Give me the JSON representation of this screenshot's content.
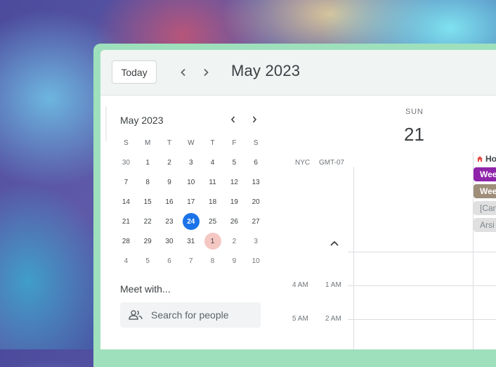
{
  "toolbar": {
    "today_label": "Today",
    "month_title": "May 2023"
  },
  "mini_calendar": {
    "title": "May 2023",
    "weekday_headers": [
      "S",
      "M",
      "T",
      "W",
      "T",
      "F",
      "S"
    ],
    "weeks": [
      [
        "30",
        "1",
        "2",
        "3",
        "4",
        "5",
        "6"
      ],
      [
        "7",
        "8",
        "9",
        "10",
        "11",
        "12",
        "13"
      ],
      [
        "14",
        "15",
        "16",
        "17",
        "18",
        "19",
        "20"
      ],
      [
        "21",
        "22",
        "23",
        "24",
        "25",
        "26",
        "27"
      ],
      [
        "28",
        "29",
        "30",
        "31",
        "1",
        "2",
        "3"
      ],
      [
        "4",
        "5",
        "6",
        "7",
        "8",
        "9",
        "10"
      ]
    ],
    "selected_day": "24",
    "highlighted_day": "1",
    "selected_color": "#1a73e8",
    "highlight_color": "#f4c7c3"
  },
  "meet": {
    "title": "Meet with...",
    "search_placeholder": "Search for people"
  },
  "day_view": {
    "day_name": "SUN",
    "day_number": "21",
    "timezones": [
      "NYC",
      "GMT-07"
    ],
    "time_rows": [
      {
        "local": "4 AM",
        "alt": "1 AM"
      },
      {
        "local": "5 AM",
        "alt": "2 AM"
      }
    ],
    "events": [
      {
        "label": "Ho",
        "color": "#ffffff",
        "text_color": "#3c4043",
        "icon": "home-icon"
      },
      {
        "label": "Wee",
        "color": "#8e24aa",
        "text_color": "#ffffff"
      },
      {
        "label": "Wee",
        "color": "#9e8e7a",
        "text_color": "#ffffff"
      },
      {
        "label": "[Can",
        "color": "#e0e0e0",
        "text_color": "#80868b"
      },
      {
        "label": "Arsi",
        "color": "#e0e0e0",
        "text_color": "#80868b"
      }
    ]
  }
}
